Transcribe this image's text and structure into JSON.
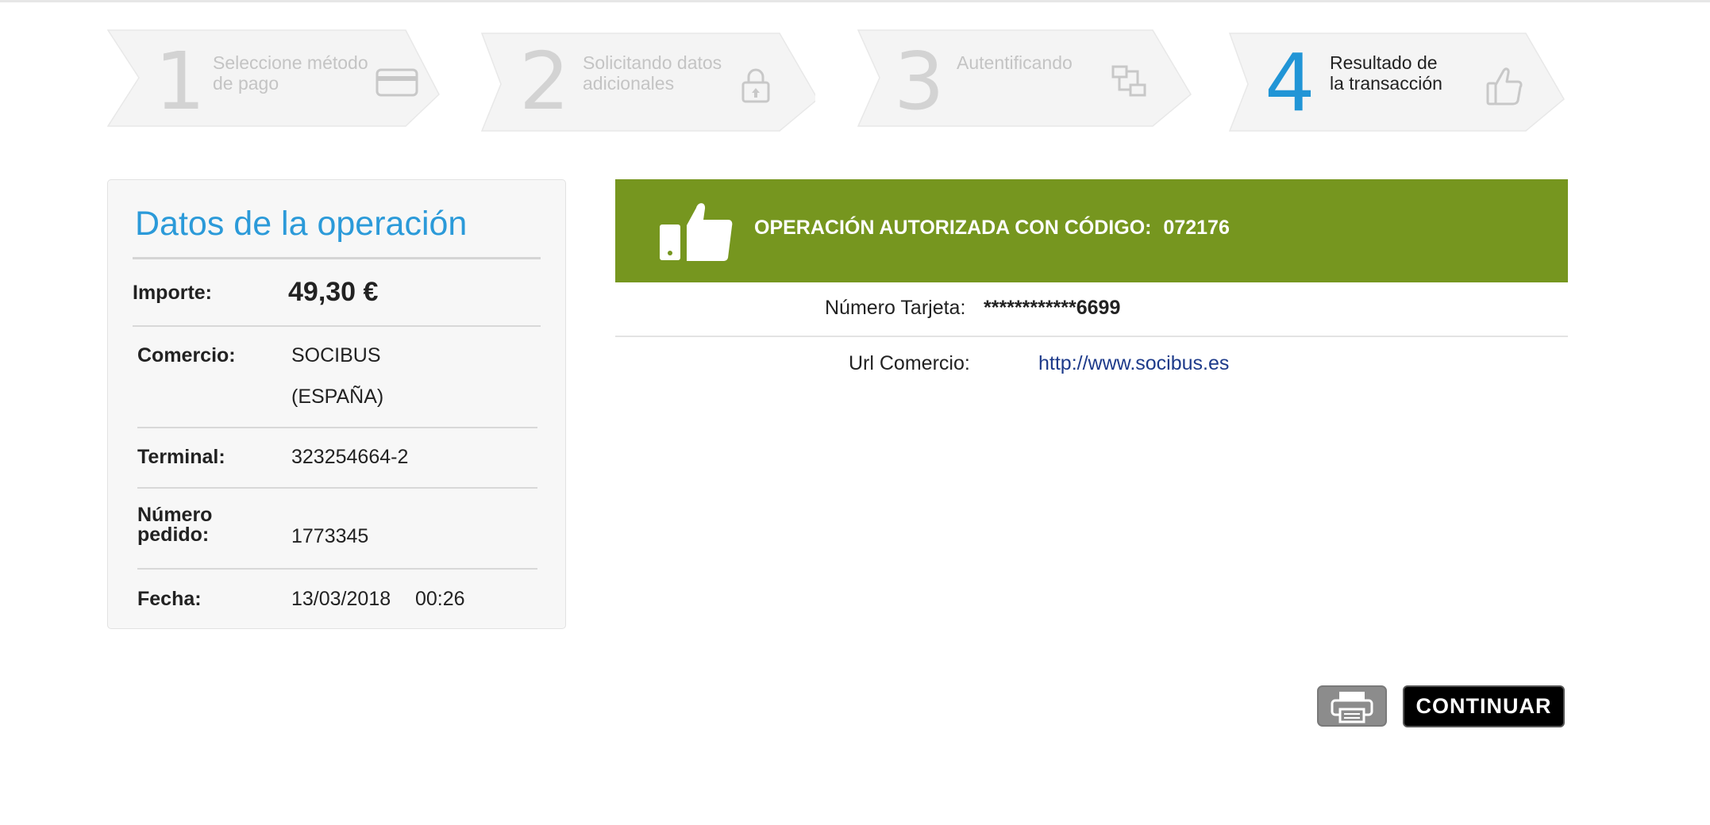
{
  "steps": [
    {
      "number": "1",
      "label": "Seleccione método de pago",
      "icon": "credit-card-icon",
      "active": false
    },
    {
      "number": "2",
      "label": "Solicitando datos adicionales",
      "icon": "lock-icon",
      "active": false
    },
    {
      "number": "3",
      "label": "Autentificando",
      "icon": "network-icon",
      "active": false
    },
    {
      "number": "4",
      "label": "Resultado de la transacción",
      "icon": "thumbs-up-icon",
      "active": true
    }
  ],
  "operation": {
    "title": "Datos de la operación",
    "importe_label": "Importe:",
    "importe_value": "49,30  €",
    "comercio_label": "Comercio:",
    "comercio_value_1": "SOCIBUS",
    "comercio_value_2": "(ESPAÑA)",
    "terminal_label": "Terminal:",
    "terminal_value": "323254664-2",
    "pedido_label_1": "Número",
    "pedido_label_2": "pedido:",
    "pedido_value": "1773345",
    "fecha_label": "Fecha:",
    "fecha_value": "13/03/2018",
    "hora_value": "00:26"
  },
  "result": {
    "banner_text": "OPERACIÓN AUTORIZADA CON CÓDIGO:",
    "code": "072176",
    "banner_color": "#76961f",
    "card_label": "Número Tarjeta:",
    "card_value": "************6699",
    "url_label": "Url Comercio:",
    "url_value": "http://www.socibus.es"
  },
  "buttons": {
    "print_icon": "printer-icon",
    "continue_label": "CONTINUAR"
  },
  "colors": {
    "accent_blue": "#2195d6",
    "title_blue": "#2b9ad9",
    "link_blue": "#1d3a8a"
  }
}
